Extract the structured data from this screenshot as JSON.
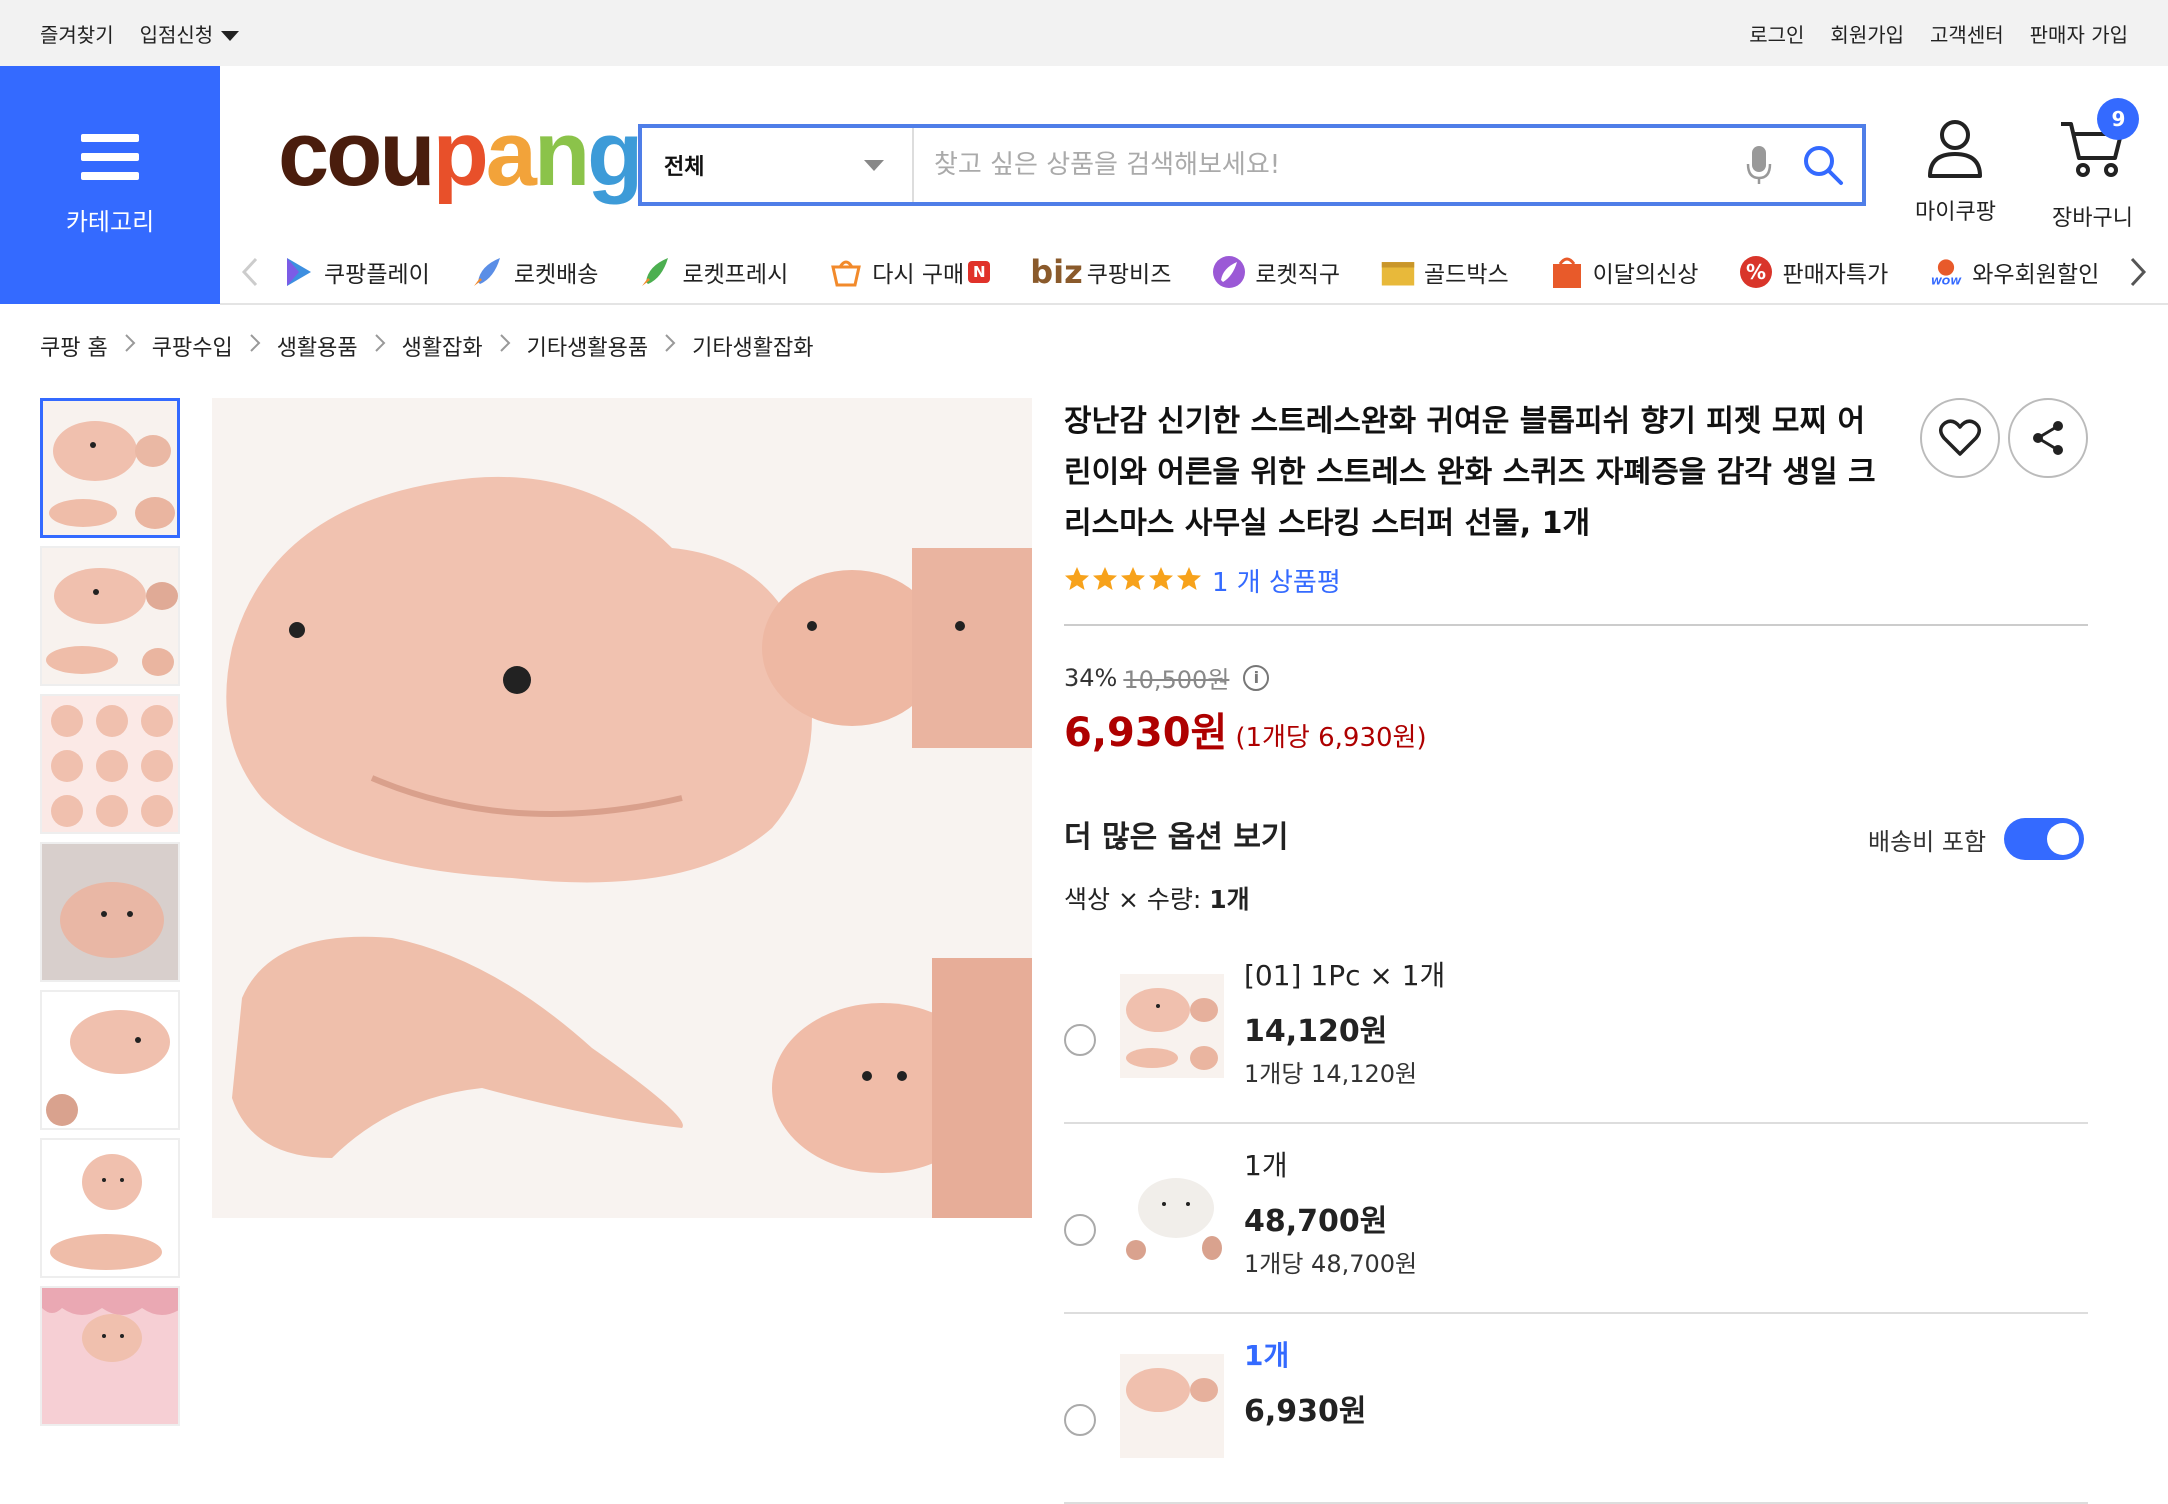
{
  "topbar": {
    "left": [
      "즐겨찾기",
      "입점신청"
    ],
    "right": [
      "로그인",
      "회원가입",
      "고객센터",
      "판매자 가입"
    ]
  },
  "category_label": "카테고리",
  "logo_letters": [
    "c",
    "o",
    "u",
    "p",
    "a",
    "n",
    "g"
  ],
  "colors": {
    "accent": "#346aff",
    "price": "#ae0000",
    "star": "#f7a21b",
    "logo": [
      "#4a1d0d",
      "#4a1d0d",
      "#4a1d0d",
      "#e8502a",
      "#f2a33a",
      "#8bc34a",
      "#3d9bd8"
    ]
  },
  "search": {
    "scope": "전체",
    "placeholder": "찾고 싶은 상품을 검색해보세요!"
  },
  "user_menu": {
    "mycoupang": "마이쿠팡",
    "cart": "장바구니",
    "cart_count": "9"
  },
  "nav_items": [
    {
      "label": "쿠팡플레이",
      "icon": "play-icon"
    },
    {
      "label": "로켓배송",
      "icon": "rocket-icon"
    },
    {
      "label": "로켓프레시",
      "icon": "rocket-fresh-icon"
    },
    {
      "label": "다시 구매",
      "icon": "rebuy-icon",
      "badge": "N"
    },
    {
      "label": "쿠팡비즈",
      "icon": "biz-icon",
      "prefix": "biz"
    },
    {
      "label": "로켓직구",
      "icon": "rocket-global-icon"
    },
    {
      "label": "골드박스",
      "icon": "goldbox-icon"
    },
    {
      "label": "이달의신상",
      "icon": "new-bag-icon"
    },
    {
      "label": "판매자특가",
      "icon": "percent-icon"
    },
    {
      "label": "와우회원할인",
      "icon": "wow-icon"
    }
  ],
  "breadcrumbs": [
    "쿠팡 홈",
    "쿠팡수입",
    "생활용품",
    "생활잡화",
    "기타생활용품",
    "기타생활잡화"
  ],
  "product": {
    "title": "장난감 신기한 스트레스완화 귀여운 블롭피쉬 향기 피젯 모찌 어린이와 어른을 위한 스트레스 완화 스퀴즈 자폐증을 감각 생일 크리스마스 사무실 스타킹 스터퍼 선물, 1개",
    "rating": 5,
    "review_count": "1 개 상품평",
    "discount": "34%",
    "original_price": "10,500원",
    "price": "6,930원",
    "unit_price": "(1개당 6,930원)"
  },
  "options": {
    "heading": "더 많은 옵션 보기",
    "shipping_label": "배송비 포함",
    "shipping_included": true,
    "qty_label": "색상 × 수량:",
    "qty_value": "1개",
    "items": [
      {
        "name": "[01] 1Pc × 1개",
        "price": "14,120원",
        "per": "1개당 14,120원"
      },
      {
        "name": "1개",
        "price": "48,700원",
        "per": "1개당 48,700원"
      },
      {
        "name": "1개",
        "price": "6,930원",
        "per": ""
      }
    ]
  }
}
